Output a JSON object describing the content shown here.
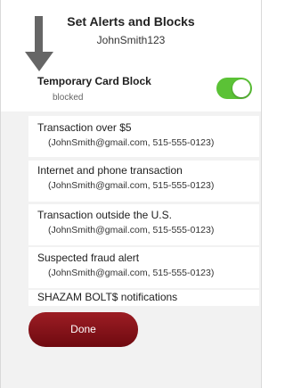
{
  "header": {
    "title": "Set Alerts and Blocks",
    "username": "JohnSmith123"
  },
  "card_block": {
    "title": "Temporary Card Block",
    "status": "blocked",
    "toggle_on": true
  },
  "alerts": [
    {
      "title": "Transaction over $5",
      "contact": "(JohnSmith@gmail.com, 515-555-0123)"
    },
    {
      "title": "Internet and phone transaction",
      "contact": "(JohnSmith@gmail.com, 515-555-0123)"
    },
    {
      "title": "Transaction outside the U.S.",
      "contact": "(JohnSmith@gmail.com, 515-555-0123)"
    },
    {
      "title": "Suspected fraud alert",
      "contact": "(JohnSmith@gmail.com, 515-555-0123)"
    },
    {
      "title": "SHAZAM BOLT$ notifications"
    }
  ],
  "done_label": "Done",
  "colors": {
    "toggle_on": "#5bc236",
    "done_button": "#8a141b",
    "arrow": "#666666"
  }
}
